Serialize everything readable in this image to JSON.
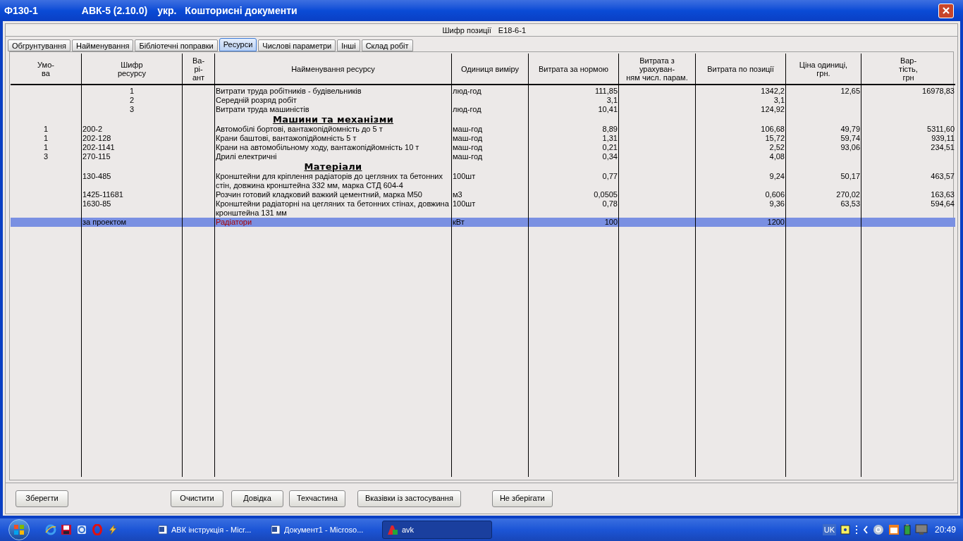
{
  "window": {
    "title_parts": [
      "Ф130-1",
      "АВК-5 (2.10.0)",
      "укр.",
      "Кошторисні документи"
    ]
  },
  "position_code": {
    "label": "Шифр позиції",
    "value": "E18-6-1"
  },
  "tabs": [
    {
      "label": "Обгрунтування",
      "selected": false
    },
    {
      "label": "Найменування",
      "selected": false
    },
    {
      "label": "Бібліотечні поправки",
      "selected": false
    },
    {
      "label": "Ресурси",
      "selected": true
    },
    {
      "label": "Числові параметри",
      "selected": false
    },
    {
      "label": "Інші",
      "selected": false
    },
    {
      "label": "Склад робіт",
      "selected": false
    }
  ],
  "table": {
    "columns": [
      {
        "lines": [
          "Умо-",
          "ва"
        ]
      },
      {
        "lines": [
          "Шифр",
          "ресурсу"
        ]
      },
      {
        "lines": [
          "Ва-",
          "рі-",
          "ант"
        ]
      },
      {
        "lines": [
          "Найменування ресурсу"
        ]
      },
      {
        "lines": [
          "Одиниця виміру"
        ]
      },
      {
        "lines": [
          "Витрата за нормою"
        ]
      },
      {
        "lines": [
          "Витрата з",
          "урахуван-",
          "ням числ. парам."
        ]
      },
      {
        "lines": [
          "Витрата по позиції"
        ]
      },
      {
        "lines": [
          "Ціна одиниці,",
          "грн."
        ]
      },
      {
        "lines": [
          "Вар-",
          "тість,",
          "грн"
        ]
      }
    ],
    "rows": [
      {
        "kind": "resource",
        "selected": false,
        "cells": [
          "",
          "1",
          "",
          "Витрати труда робітників - будівельників",
          "люд-год",
          "111,85",
          "",
          "1342,2",
          "12,65",
          "16978,83"
        ]
      },
      {
        "kind": "resource",
        "selected": false,
        "cells": [
          "",
          "2",
          "",
          "Середній розряд робіт",
          "",
          "3,1",
          "",
          "3,1",
          "",
          ""
        ]
      },
      {
        "kind": "resource",
        "selected": false,
        "cells": [
          "",
          "3",
          "",
          "Витрати труда машиністів",
          "люд-год",
          "10,41",
          "",
          "124,92",
          "",
          ""
        ]
      },
      {
        "kind": "section",
        "selected": false,
        "title": "Машини та механізми"
      },
      {
        "kind": "resource",
        "selected": false,
        "cells": [
          "1",
          "200-2",
          "",
          "Автомобілі бортові, вантажопідйомність до 5 т",
          "маш-год",
          "8,89",
          "",
          "106,68",
          "49,79",
          "5311,60"
        ]
      },
      {
        "kind": "resource",
        "selected": false,
        "cells": [
          "1",
          "202-128",
          "",
          "Крани баштові, вантажопідйомність 5 т",
          "маш-год",
          "1,31",
          "",
          "15,72",
          "59,74",
          "939,11"
        ]
      },
      {
        "kind": "resource",
        "selected": false,
        "cells": [
          "1",
          "202-1141",
          "",
          "Крани на автомобільному ходу, вантажопідйомність 10 т",
          "маш-год",
          "0,21",
          "",
          "2,52",
          "93,06",
          "234,51"
        ]
      },
      {
        "kind": "resource",
        "selected": false,
        "cells": [
          "3",
          "270-115",
          "",
          "Дрилі електричні",
          "маш-год",
          "0,34",
          "",
          "4,08",
          "",
          ""
        ]
      },
      {
        "kind": "section",
        "selected": false,
        "title": "Матеріали"
      },
      {
        "kind": "resource",
        "selected": false,
        "cells": [
          "",
          "130-485",
          "",
          "Кронштейни для кріплення радіаторів до цегляних та бетонних стін, довжина кронштейна 332 мм, марка СТД 604-4",
          "100шт",
          "0,77",
          "",
          "9,24",
          "50,17",
          "463,57"
        ]
      },
      {
        "kind": "resource",
        "selected": false,
        "cells": [
          "",
          "1425-11681",
          "",
          "Розчин готовий кладковий важкий цементний, марка М50",
          "м3",
          "0,0505",
          "",
          "0,606",
          "270,02",
          "163,63"
        ]
      },
      {
        "kind": "resource",
        "selected": false,
        "cells": [
          "",
          "1630-85",
          "",
          "Кронштейни радіаторні на цегляних та бетонних стінах, довжина кронштейна 131 мм",
          "100шт",
          "0,78",
          "",
          "9,36",
          "63,53",
          "594,64"
        ]
      },
      {
        "kind": "resource",
        "selected": true,
        "cells": [
          "",
          "за проектом",
          "",
          "Радіатори",
          "кВт",
          "100",
          "",
          "1200",
          "",
          ""
        ]
      }
    ]
  },
  "buttons": [
    {
      "label": "Зберегти"
    },
    {
      "label": "Очистити"
    },
    {
      "label": "Довідка"
    },
    {
      "label": "Техчастина"
    },
    {
      "label": "Вказівки із застосування"
    },
    {
      "label": "Не зберігати"
    }
  ],
  "taskbar": {
    "tasks": [
      {
        "label": "АВК інструкція - Micr...",
        "selected": false,
        "kind": "word"
      },
      {
        "label": "Документ1 - Microso...",
        "selected": false,
        "kind": "word"
      },
      {
        "label": "avk",
        "selected": true,
        "kind": "avk"
      }
    ],
    "language": "UK",
    "time": "20:49"
  }
}
